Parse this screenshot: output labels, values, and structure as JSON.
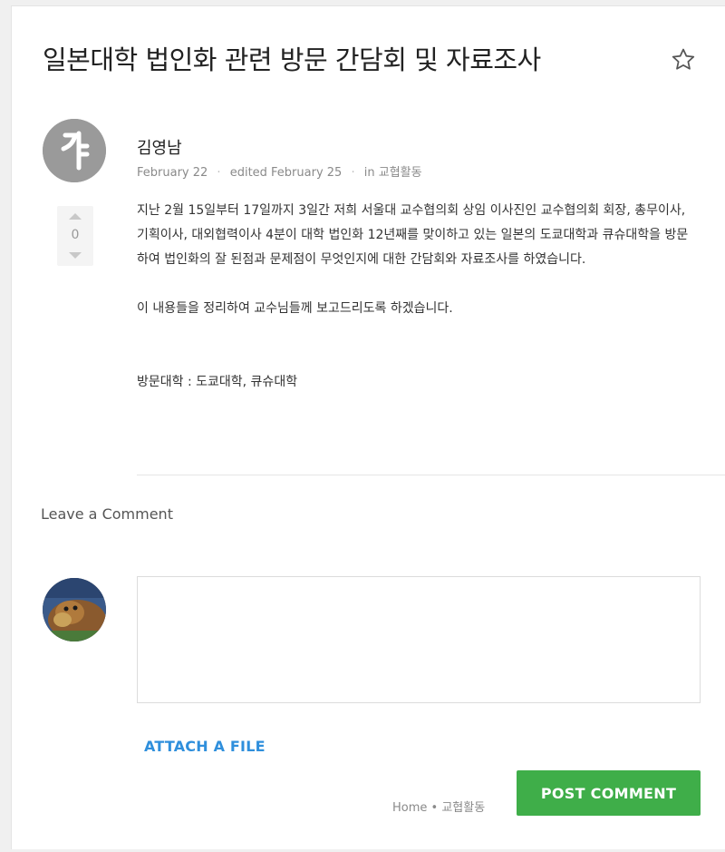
{
  "discussion": {
    "title": "일본대학 법인화 관련 방문 간담회 및 자료조사",
    "author": "김영남",
    "date": "February 22",
    "edited": "edited February 25",
    "category_prefix": "in",
    "category": "교협활동",
    "votes": "0",
    "body": [
      "지난 2월 15일부터 17일까지 3일간 저희 서울대 교수협의회 상임 이사진인 교수협의회 회장, 총무이사, 기획이사, 대외협력이사 4분이 대학 법인화 12년째를 맞이하고 있는 일본의 도쿄대학과 큐슈대학을 방문하여 법인화의 잘 된점과 문제점이 무엇인지에 대한 간담회와 자료조사를 하였습니다.",
      "이 내용들을 정리하여 교수님들께 보고드리도록 하겠습니다.",
      "방문대학 : 도쿄대학, 큐슈대학"
    ]
  },
  "comment_form": {
    "heading": "Leave a Comment",
    "textarea_value": "",
    "attach_label": "ATTACH A FILE",
    "post_label": "POST COMMENT"
  },
  "breadcrumb": {
    "home": "Home",
    "separator": "•",
    "category": "교협활동"
  },
  "icons": {
    "favorite": "star-outline-icon",
    "vote_up": "caret-up-icon",
    "vote_down": "caret-down-icon"
  },
  "colors": {
    "post_button": "#3fae49",
    "link_blue": "#2f8fdc",
    "avatar_gray": "#9a9a9a"
  }
}
